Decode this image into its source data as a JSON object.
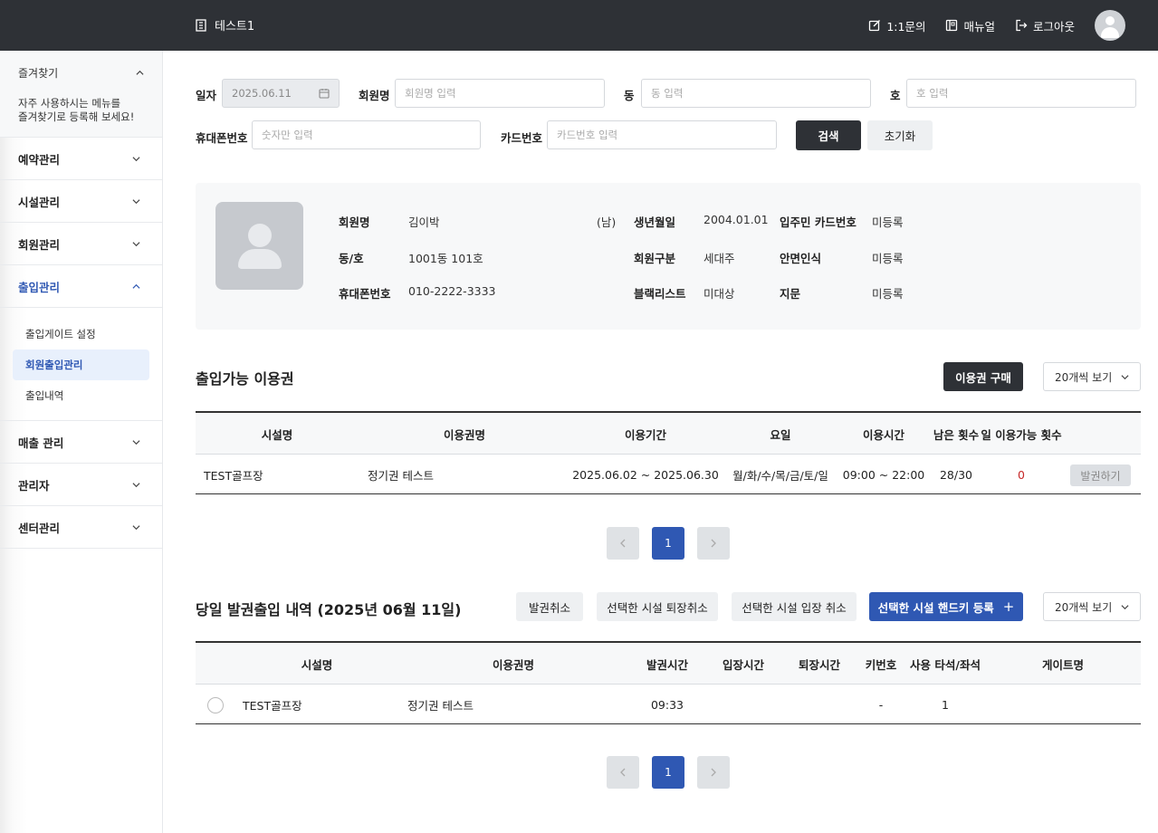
{
  "topbar": {
    "title": "테스트1",
    "inquiry": "1:1문의",
    "manual": "매뉴얼",
    "logout": "로그아웃"
  },
  "sidebar": {
    "favorites": {
      "label": "즐겨찾기",
      "desc_line1": "자주 사용하시는 메뉴를",
      "desc_line2": "즐겨찾기로 등록해 보세요!"
    },
    "items": [
      {
        "label": "예약관리"
      },
      {
        "label": "시설관리"
      },
      {
        "label": "회원관리"
      },
      {
        "label": "출입관리"
      },
      {
        "label": "매출 관리"
      },
      {
        "label": "관리자"
      },
      {
        "label": "센터관리"
      }
    ],
    "subitems": [
      {
        "label": "출입게이트 설정"
      },
      {
        "label": "회원출입관리"
      },
      {
        "label": "출입내역"
      }
    ]
  },
  "search": {
    "date_label": "일자",
    "date_value": "2025.06.11",
    "name_label": "회원명",
    "name_placeholder": "회원명 입력",
    "dong_label": "동",
    "dong_placeholder": "동 입력",
    "ho_label": "호",
    "ho_placeholder": "호 입력",
    "phone_label": "휴대폰번호",
    "phone_placeholder": "숫자만 입력",
    "card_label": "카드번호",
    "card_placeholder": "카드번호 입력",
    "search_btn": "검색",
    "reset_btn": "초기화"
  },
  "member": {
    "name_key": "회원명",
    "name_val": "김이박",
    "gender": "(남)",
    "dongho_key": "동/호",
    "dongho_val": "1001동 101호",
    "phone_key": "휴대폰번호",
    "phone_val": "010-2222-3333",
    "birth_key": "생년월일",
    "birth_val": "2004.01.01",
    "type_key": "회원구분",
    "type_val": "세대주",
    "black_key": "블랙리스트",
    "black_val": "미대상",
    "card_key": "입주민 카드번호",
    "card_val": "미등록",
    "face_key": "안면인식",
    "face_val": "미등록",
    "finger_key": "지문",
    "finger_val": "미등록"
  },
  "passes": {
    "title": "출입가능 이용권",
    "buy_btn": "이용권 구매",
    "page_size": "20개씩 보기",
    "headers": [
      "시설명",
      "이용권명",
      "이용기간",
      "요일",
      "이용시간",
      "남은 횟수",
      "일 이용가능 횟수"
    ],
    "rows": [
      {
        "facility": "TEST골프장",
        "pass": "정기권 테스트",
        "period": "2025.06.02 ~ 2025.06.30",
        "days": "월/화/수/목/금/토/일",
        "time": "09:00 ~ 22:00",
        "remaining": "28/30",
        "daily": "0",
        "action": "발권하기"
      }
    ],
    "page": "1"
  },
  "today": {
    "title": "당일 발권출입 내역 (2025년 06월 11일)",
    "cancel_issue": "발권취소",
    "cancel_exit": "선택한 시설 퇴장취소",
    "cancel_enter": "선택한 시설 입장 취소",
    "register_key": "선택한 시설 핸드키 등록",
    "register_plus": "+",
    "page_size": "20개씩 보기",
    "headers": [
      "시설명",
      "이용권명",
      "발권시간",
      "입장시간",
      "퇴장시간",
      "키번호",
      "사용 타석/좌석",
      "게이트명"
    ],
    "rows": [
      {
        "facility": "TEST골프장",
        "pass": "정기권 테스트",
        "issued": "09:33",
        "entered": "",
        "exited": "",
        "key": "-",
        "seat": "1",
        "gate": ""
      }
    ],
    "page": "1"
  },
  "colors": {
    "topbar": "#2e3136",
    "accent": "#2f58b3",
    "highlight": "#c62828"
  }
}
